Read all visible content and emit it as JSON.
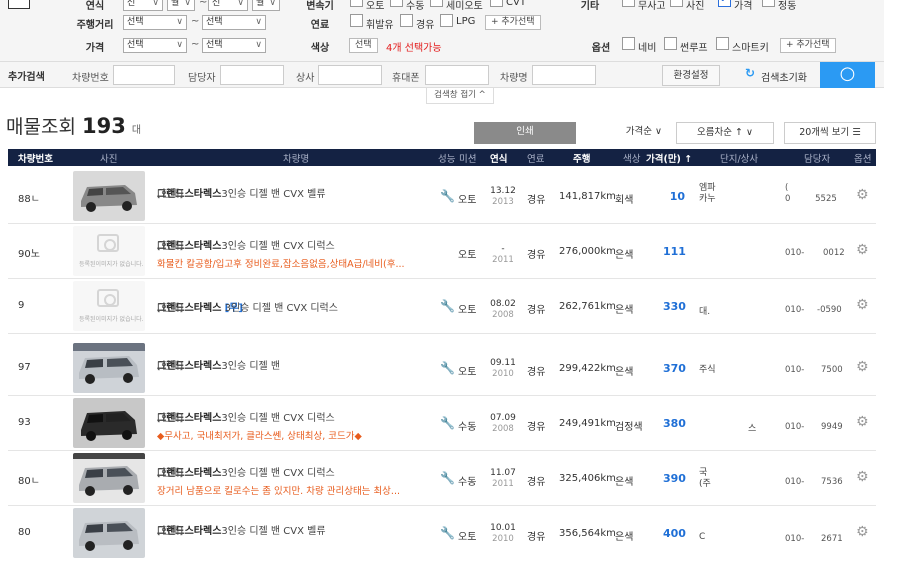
{
  "filters": {
    "row1": {
      "label_a": "연식",
      "label_b": "변속기",
      "label_c": "기타",
      "sel_year_from": "선",
      "sel_month_from": "월",
      "sel_year_to": "선",
      "sel_month_to": "월",
      "trans_opts": [
        "오토",
        "수동",
        "세미오토",
        "CVT"
      ],
      "etc_opts": [
        "무사고",
        "사진",
        "가격",
        "정동"
      ]
    },
    "row2": {
      "label_km": "주행거리",
      "km_from": "선택",
      "km_to": "선택",
      "label_fuel": "연료",
      "fuel_opts": [
        "휘발유",
        "경유",
        "LPG"
      ],
      "add_btn": "+ 추가선택"
    },
    "row3": {
      "label_price": "가격",
      "price_from": "선택",
      "price_to": "선택",
      "label_color": "색상",
      "color_btn": "선택",
      "color_note": "4개 선택가능",
      "label_opt": "옵션",
      "opt_opts": [
        "네비",
        "썬루프",
        "스마트키"
      ],
      "add_btn": "+ 추가선택"
    }
  },
  "search": {
    "label": "추가검색",
    "f1": "차량번호",
    "f2": "담당자",
    "f3": "상사",
    "f4": "휴대폰",
    "f5": "차량명",
    "env_btn": "환경설정",
    "reset_btn": "검색초기화",
    "fold": "검색창 접기 ^"
  },
  "summary": {
    "title": "매물조회",
    "count": "193",
    "unit": "대"
  },
  "controls": {
    "print": "인쇄",
    "sort1": "가격순 ∨",
    "sort2": "오름차순 ↑ ∨",
    "perpage": "20개씩 보기 ☰"
  },
  "columns": [
    "차량번호",
    "사진",
    "차량명",
    "성능",
    "미션",
    "연식",
    "연료",
    "주행",
    "색상",
    "가격(만) ↑",
    "단지/상사",
    "담당자",
    "옵션"
  ],
  "rows": [
    {
      "id": "88ㄴ",
      "name_pre": "[현대]",
      "name": "그랜드스타렉스",
      "name_post": "3인승 디젤 밴 CVX 벨류",
      "sub": "",
      "trans": "오토",
      "year": "13.12",
      "year2": "2013",
      "fuel": "경유",
      "km": "141,817km",
      "color": "회색",
      "price": "10",
      "dealer1": "엠파",
      "dealer2": "카누",
      "mgr1": "(",
      "mgr2": "0",
      "mgr3": "5525"
    },
    {
      "id": "90노",
      "name_pre": "[현대]",
      "name": "그랜드스타렉스",
      "name_post": "3인승 디젤 밴 CVX 디럭스",
      "sub": "화물칸 칼공함/입고후 정비완료,잡소음없음,상태A급/네비(후...",
      "trans": "오토",
      "year": "-",
      "year2": "2011",
      "fuel": "경유",
      "km": "276,000km",
      "color": "은색",
      "price": "111",
      "dealer1": "",
      "dealer2": "",
      "mgr1": "",
      "mgr2": "010-",
      "mgr3": "0012"
    },
    {
      "id": "9",
      "name_pre": "[현대]",
      "name": "그랜드스타렉스",
      "name_post": "3인승 디젤 밴 CVX 디럭스",
      "name_tag": "[무]",
      "sub": "",
      "trans": "오토",
      "year": "08.02",
      "year2": "2008",
      "fuel": "경유",
      "km": "262,761km",
      "color": "은색",
      "price": "330",
      "dealer1": "",
      "dealer2": "대.",
      "mgr1": "",
      "mgr2": "010-",
      "mgr3": "-0590"
    },
    {
      "id": "97",
      "name_pre": "[현대]",
      "name": "그랜드스타렉스",
      "name_post": "3인승 디젤 밴",
      "sub": "",
      "trans": "오토",
      "year": "09.11",
      "year2": "2010",
      "fuel": "경유",
      "km": "299,422km",
      "color": "은색",
      "price": "370",
      "dealer1": "",
      "dealer2": "주식",
      "mgr1": "",
      "mgr2": "010-",
      "mgr3": "7500"
    },
    {
      "id": "93",
      "name_pre": "[현대]",
      "name": "그랜드스타렉스",
      "name_post": "3인승 디젤 밴 CVX 디럭스",
      "sub": "◆무사고, 국내최저가, 클라스쎈, 상태최상, 코드가◆",
      "trans": "수동",
      "year": "07.09",
      "year2": "2008",
      "fuel": "경유",
      "km": "249,491km",
      "color": "검정색",
      "price": "380",
      "dealer1": "",
      "dealer2": "스",
      "mgr1": "",
      "mgr2": "010-",
      "mgr3": "9949"
    },
    {
      "id": "80ㄴ",
      "name_pre": "[현대]",
      "name": "그랜드스타렉스",
      "name_post": "3인승 디젤 밴 CVX 디럭스",
      "sub": "장거리 남품으로 킬로수는 좀 있지만. 차량 관리상태는 최상...",
      "trans": "수동",
      "year": "11.07",
      "year2": "2011",
      "fuel": "경유",
      "km": "325,406km",
      "color": "은색",
      "price": "390",
      "dealer1": "국",
      "dealer2": "(주",
      "mgr1": "",
      "mgr2": "010-",
      "mgr3": "7536"
    },
    {
      "id": "80",
      "name_pre": "[현대]",
      "name": "그랜드스타렉스",
      "name_post": "3인승 디젤 밴 CVX 벨류",
      "sub": "",
      "trans": "오토",
      "year": "10.01",
      "year2": "2010",
      "fuel": "경유",
      "km": "356,564km",
      "color": "은색",
      "price": "400",
      "dealer1": "",
      "dealer2": "C",
      "mgr1": "",
      "mgr2": "010-",
      "mgr3": "2671"
    }
  ],
  "placeholder_text": "등록된이미지가 없습니다.",
  "colors": {
    "header_bg": "#142243",
    "price": "#1f6fd6",
    "search_btn": "#2b9af3",
    "sub_text": "#e85c1d"
  }
}
